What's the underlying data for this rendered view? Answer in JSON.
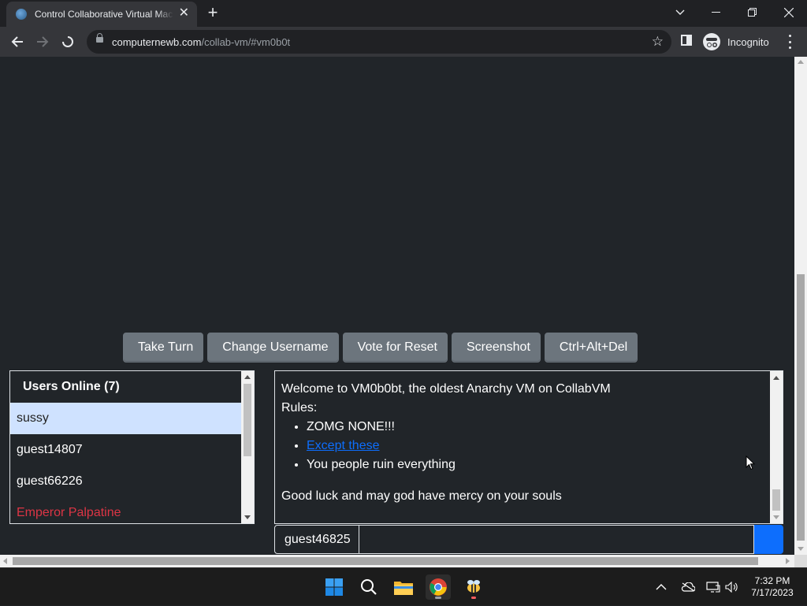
{
  "browser": {
    "tab_title": "Control Collaborative Virtual Machines",
    "url_host": "computernewb.com",
    "url_path": "/collab-vm/#vm0b0t",
    "incognito_label": "Incognito"
  },
  "vm_buttons": [
    {
      "icon": "",
      "label": "Take Turn"
    },
    {
      "icon": "",
      "label": "Change Username"
    },
    {
      "icon": "",
      "label": "Vote for Reset"
    },
    {
      "icon": "",
      "label": "Screenshot"
    },
    {
      "icon": "",
      "label": "Ctrl+Alt+Del"
    }
  ],
  "users": {
    "header_icon": "",
    "header": "Users Online (7)",
    "list": [
      {
        "name": "sussy",
        "selected": true
      },
      {
        "name": "guest14807"
      },
      {
        "name": "guest66226"
      },
      {
        "name": "Emperor Palpatine",
        "color": "#dc3545"
      }
    ]
  },
  "chat": {
    "welcome": "Welcome to VM0b0bt, the oldest Anarchy VM on CollabVM",
    "rules_label": "Rules:",
    "rule_1": "ZOMG NONE!!!",
    "rule_2_link": "Except these",
    "rule_3": "You people ruin everything",
    "footer": "Good luck and may god have mercy on your souls"
  },
  "input": {
    "username": "guest46825",
    "message_value": "",
    "send_icon": ""
  },
  "taskbar": {
    "time": "7:32 PM",
    "date": "7/17/2023"
  },
  "colors": {
    "page_bg": "#212529",
    "button_secondary": "#6c757d",
    "selected_row": "#cfe2ff",
    "danger": "#dc3545",
    "primary": "#0d6efd"
  }
}
